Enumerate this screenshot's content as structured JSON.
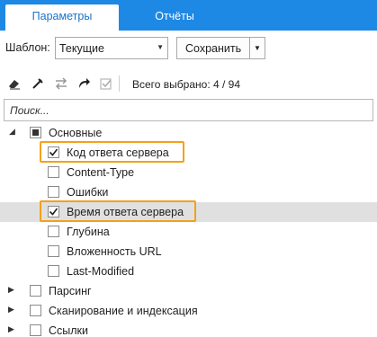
{
  "tabs": [
    {
      "label": "Параметры",
      "active": true
    },
    {
      "label": "Отчёты",
      "active": false
    }
  ],
  "template": {
    "label": "Шаблон:",
    "selected": "Текущие",
    "save_label": "Сохранить"
  },
  "toolbar": {
    "icons": [
      "eraser-icon",
      "unpin-icon",
      "swap-icon",
      "redo-arrow-icon",
      "check-square-icon"
    ],
    "selected_text": "Всего выбрано: 4 / 94"
  },
  "search": {
    "placeholder": "Поиск..."
  },
  "tree": {
    "group_main": {
      "label": "Основные",
      "state": "partial",
      "expanded": true
    },
    "children": [
      {
        "label": "Код ответа сервера",
        "checked": true,
        "highlighted_box": true
      },
      {
        "label": "Content-Type",
        "checked": false
      },
      {
        "label": "Ошибки",
        "checked": false
      },
      {
        "label": "Время ответа сервера",
        "checked": true,
        "highlighted_box": true,
        "selected_row": true
      },
      {
        "label": "Глубина",
        "checked": false
      },
      {
        "label": "Вложенность URL",
        "checked": false
      },
      {
        "label": "Last-Modified",
        "checked": false
      }
    ],
    "groups_collapsed": [
      {
        "label": "Парсинг",
        "checked": false
      },
      {
        "label": "Сканирование и индексация",
        "checked": false
      },
      {
        "label": "Ссылки",
        "checked": false
      }
    ]
  },
  "colors": {
    "tab_bar": "#1e88e5",
    "highlight_box": "#f5a01a",
    "selected_row": "#e0e0e0"
  }
}
